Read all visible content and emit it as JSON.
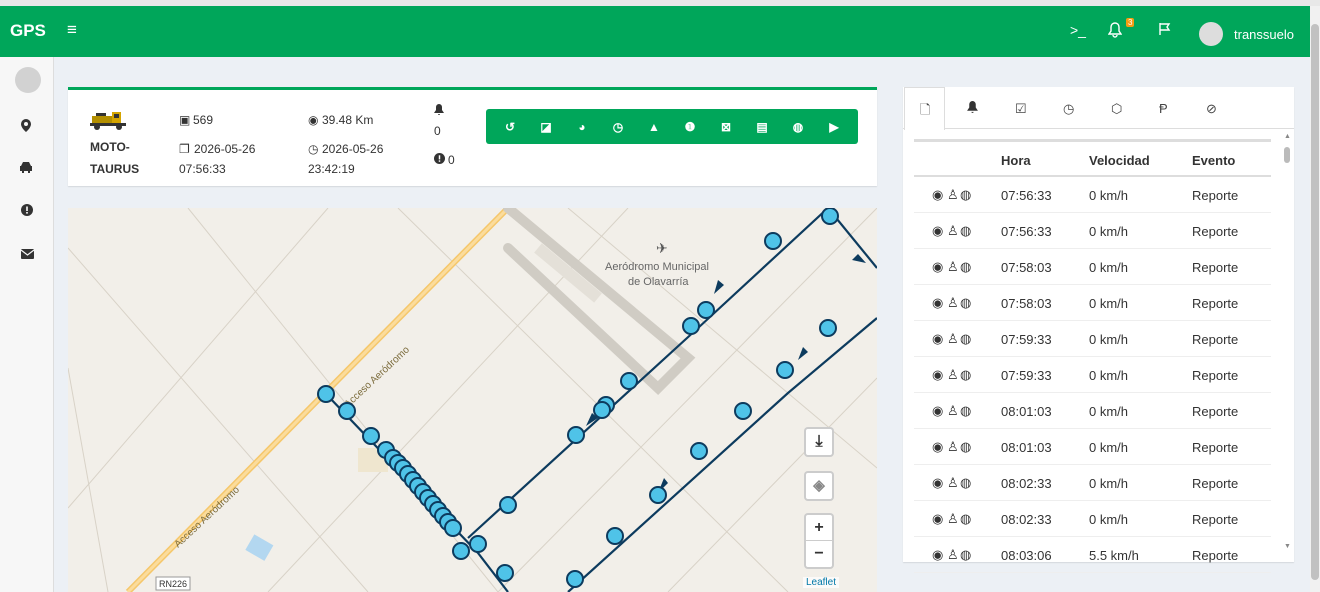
{
  "header": {
    "brand": "GPS",
    "menu_icon": "hamburger-icon",
    "terminal_icon": "terminal-icon",
    "notifications_count": "3",
    "username": "transsuelo"
  },
  "vehicle": {
    "name_line1": "MOTO-",
    "name_line2": "TAURUS",
    "id_value": "569",
    "date1_line1": "2026-05-26",
    "date1_line2": "07:56:33",
    "distance": "39.48 Km",
    "date2_line1": "2026-05-26",
    "date2_line2": "23:42:19",
    "alerts_count": "0",
    "warnings_count": "0"
  },
  "toolbar": {
    "buttons": [
      "history-icon",
      "edit-icon",
      "speedometer-icon",
      "clock-icon",
      "warning-icon",
      "exclamation-icon",
      "excel-icon",
      "document-icon",
      "globe-icon",
      "play-icon"
    ]
  },
  "map": {
    "label_airport_line1": "Aeródromo Municipal",
    "label_airport_line2": "de Olavarría",
    "road_label_1": "Acceso Aeródromo",
    "road_label_2": "Acceso Aeródromo",
    "route_shield": "RN226",
    "zoom_in": "+",
    "zoom_out": "−",
    "attribution": "Leaflet"
  },
  "events_panel": {
    "columns": [
      "",
      "Hora",
      "Velocidad",
      "Evento"
    ],
    "rows": [
      {
        "hora": "07:56:33",
        "velocidad": "0 km/h",
        "evento": "Reporte"
      },
      {
        "hora": "07:56:33",
        "velocidad": "0 km/h",
        "evento": "Reporte"
      },
      {
        "hora": "07:58:03",
        "velocidad": "0 km/h",
        "evento": "Reporte"
      },
      {
        "hora": "07:58:03",
        "velocidad": "0 km/h",
        "evento": "Reporte"
      },
      {
        "hora": "07:59:33",
        "velocidad": "0 km/h",
        "evento": "Reporte"
      },
      {
        "hora": "07:59:33",
        "velocidad": "0 km/h",
        "evento": "Reporte"
      },
      {
        "hora": "08:01:03",
        "velocidad": "0 km/h",
        "evento": "Reporte"
      },
      {
        "hora": "08:01:03",
        "velocidad": "0 km/h",
        "evento": "Reporte"
      },
      {
        "hora": "08:02:33",
        "velocidad": "0 km/h",
        "evento": "Reporte"
      },
      {
        "hora": "08:02:33",
        "velocidad": "0 km/h",
        "evento": "Reporte"
      },
      {
        "hora": "08:03:06",
        "velocidad": "5.5 km/h",
        "evento": "Reporte"
      }
    ]
  },
  "colors": {
    "brand_green": "#00a65a",
    "route_dark": "#0d3b5e",
    "marker_fill": "#4fc3e8"
  }
}
